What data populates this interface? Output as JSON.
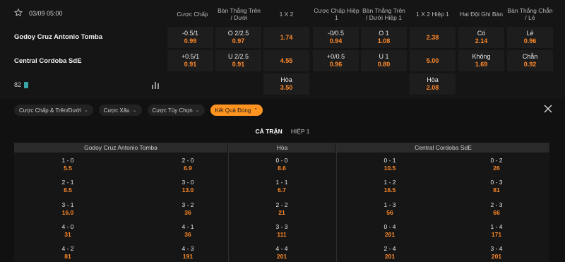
{
  "match": {
    "datetime": "03/09 05:00"
  },
  "headers": [
    "Cược Chấp",
    "Bàn Thắng Trên / Dưới",
    "1 X 2",
    "Cược Chấp Hiệp 1",
    "Bàn Thắng Trên / Dưới Hiệp 1",
    "1 X 2 Hiệp 1",
    "Hai Đội Ghi Bàn",
    "Bàn Thắng Chẵn / Lẻ"
  ],
  "teams": {
    "home": "Godoy Cruz Antonio Tomba",
    "away": "Central Cordoba SdE"
  },
  "rows": [
    {
      "cells": [
        {
          "label": "-0.5/1",
          "odds": "0.99"
        },
        {
          "label": "O 2/2.5",
          "odds": "0.97"
        },
        {
          "label": "",
          "odds": "1.74"
        },
        {
          "label": "-0/0.5",
          "odds": "0.94"
        },
        {
          "label": "O 1",
          "odds": "1.08"
        },
        {
          "label": "",
          "odds": "2.38"
        },
        {
          "label": "Có",
          "odds": "2.14"
        },
        {
          "label": "Lẻ",
          "odds": "0.96"
        }
      ]
    },
    {
      "cells": [
        {
          "label": "+0.5/1",
          "odds": "0.91"
        },
        {
          "label": "U 2/2.5",
          "odds": "0.91"
        },
        {
          "label": "",
          "odds": "4.55"
        },
        {
          "label": "+0/0.5",
          "odds": "0.96"
        },
        {
          "label": "U 1",
          "odds": "0.80"
        },
        {
          "label": "",
          "odds": "5.00"
        },
        {
          "label": "Không",
          "odds": "1.69"
        },
        {
          "label": "Chẵn",
          "odds": "0.92"
        }
      ]
    }
  ],
  "draw": {
    "ft": {
      "label": "Hòa",
      "odds": "3.50"
    },
    "ht": {
      "label": "Hòa",
      "odds": "2.08"
    }
  },
  "more_markets": {
    "count": "82"
  },
  "filter_tabs": [
    {
      "label": "Cược Chấp & Trên/Dưới",
      "active": false
    },
    {
      "label": "Cược Xâu",
      "active": false
    },
    {
      "label": "Cược Tùy Chọn",
      "active": false
    },
    {
      "label": "Kết Quả Đúng",
      "active": true
    }
  ],
  "period_tabs": {
    "full": "CẢ TRẬN",
    "half": "HIỆP 1"
  },
  "cs_headers": {
    "home": "Godoy Cruz Antonio Tomba",
    "draw": "Hòa",
    "away": "Central Cordoba SdE"
  },
  "correct_score": {
    "home_a": [
      {
        "score": "1 - 0",
        "odds": "5.5"
      },
      {
        "score": "2 - 1",
        "odds": "8.5"
      },
      {
        "score": "3 - 1",
        "odds": "16.0"
      },
      {
        "score": "4 - 0",
        "odds": "31"
      },
      {
        "score": "4 - 2",
        "odds": "81"
      }
    ],
    "home_b": [
      {
        "score": "2 - 0",
        "odds": "6.9"
      },
      {
        "score": "3 - 0",
        "odds": "13.0"
      },
      {
        "score": "3 - 2",
        "odds": "36"
      },
      {
        "score": "4 - 1",
        "odds": "36"
      },
      {
        "score": "4 - 3",
        "odds": "191"
      }
    ],
    "draw": [
      {
        "score": "0 - 0",
        "odds": "8.6"
      },
      {
        "score": "1 - 1",
        "odds": "6.7"
      },
      {
        "score": "2 - 2",
        "odds": "21"
      },
      {
        "score": "3 - 3",
        "odds": "111"
      },
      {
        "score": "4 - 4",
        "odds": "201"
      }
    ],
    "away_a": [
      {
        "score": "0 - 1",
        "odds": "10.5"
      },
      {
        "score": "1 - 2",
        "odds": "16.5"
      },
      {
        "score": "1 - 3",
        "odds": "56"
      },
      {
        "score": "0 - 4",
        "odds": "201"
      },
      {
        "score": "2 - 4",
        "odds": "201"
      }
    ],
    "away_b": [
      {
        "score": "0 - 2",
        "odds": "26"
      },
      {
        "score": "0 - 3",
        "odds": "81"
      },
      {
        "score": "2 - 3",
        "odds": "66"
      },
      {
        "score": "1 - 4",
        "odds": "171"
      },
      {
        "score": "3 - 4",
        "odds": "201"
      }
    ]
  },
  "colors": {
    "accent": "#ff9420",
    "odds": "#ff8a2a",
    "background": "#111111",
    "cell": "#1d1d1d"
  }
}
